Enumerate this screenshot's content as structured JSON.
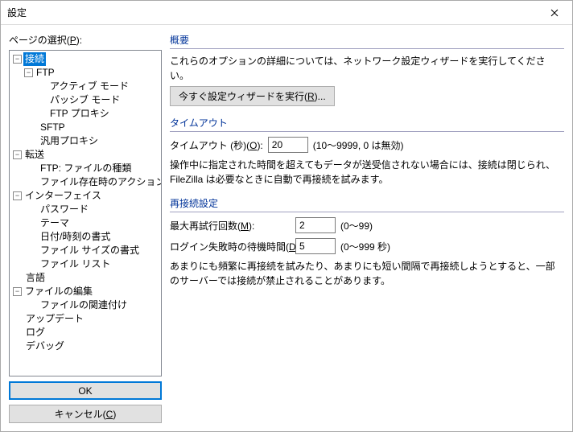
{
  "title": "設定",
  "left": {
    "label": "ページの選択(P):",
    "tree": {
      "connection": {
        "label": "接続",
        "children": {
          "ftp": {
            "label": "FTP",
            "children": {
              "active": "アクティブ モード",
              "passive": "パッシブ モード",
              "proxy": "FTP プロキシ"
            }
          },
          "sftp": "SFTP",
          "generic_proxy": "汎用プロキシ"
        }
      },
      "transfer": {
        "label": "転送",
        "children": {
          "filetypes": "FTP: ファイルの種類",
          "exists": "ファイル存在時のアクション"
        }
      },
      "interface": {
        "label": "インターフェイス",
        "children": {
          "password": "パスワード",
          "theme": "テーマ",
          "datefmt": "日付/時刻の書式",
          "sizefmt": "ファイル サイズの書式",
          "filelist": "ファイル リスト"
        }
      },
      "language": "言語",
      "fileedit": {
        "label": "ファイルの編集",
        "children": {
          "assoc": "ファイルの関連付け"
        }
      },
      "update": "アップデート",
      "log": "ログ",
      "debug": "デバッグ"
    },
    "ok": "OK",
    "cancel": "キャンセル(C)"
  },
  "right": {
    "overview": {
      "title": "概要",
      "desc": "これらのオプションの詳細については、ネットワーク設定ウィザードを実行してください。",
      "wizard": "今すぐ設定ウィザードを実行(R)..."
    },
    "timeout": {
      "title": "タイムアウト",
      "label": "タイムアウト (秒)(O):",
      "value": "20",
      "hint": "(10～9999, 0 は無効)",
      "note": "操作中に指定された時間を超えてもデータが送受信されない場合には、接続は閉じられ、FileZilla は必要なときに自動で再接続を試みます。"
    },
    "reconnect": {
      "title": "再接続設定",
      "max_label": "最大再試行回数(M):",
      "max_value": "2",
      "max_hint": "(0～99)",
      "delay_label": "ログイン失敗時の待機時間(D):",
      "delay_value": "5",
      "delay_hint": "(0～999 秒)",
      "note": "あまりにも頻繁に再接続を試みたり、あまりにも短い間隔で再接続しようとすると、一部のサーバーでは接続が禁止されることがあります。"
    }
  }
}
